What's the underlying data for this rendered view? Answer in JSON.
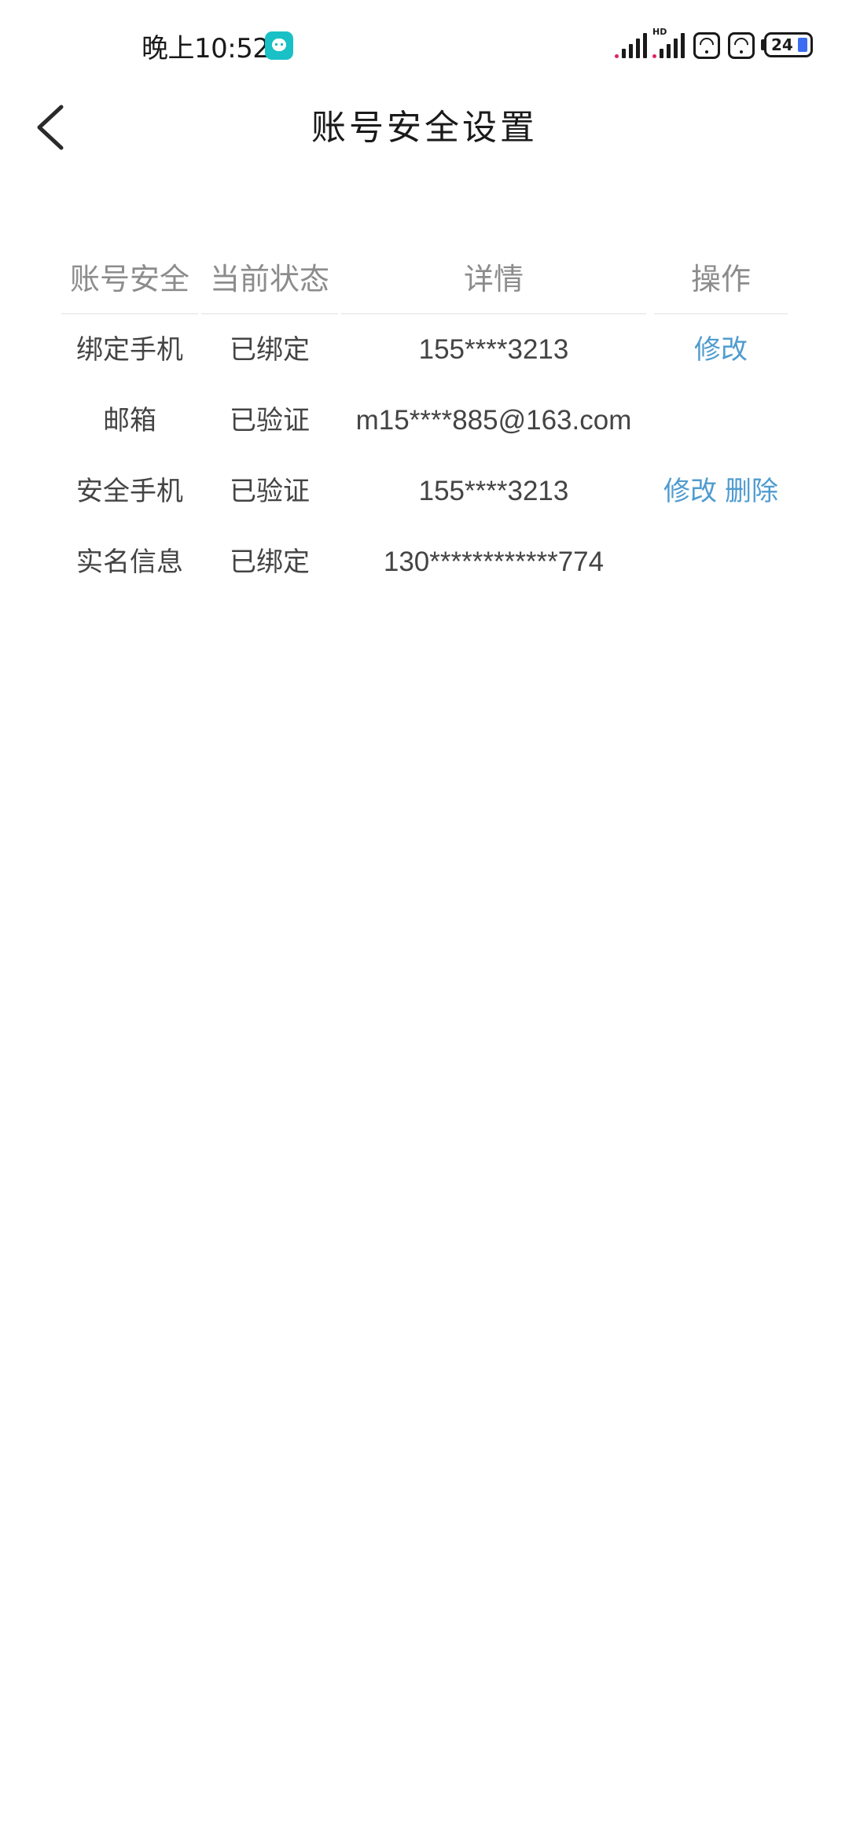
{
  "status_bar": {
    "time": "晚上10:52",
    "app_icon": "chat-bubble-icon",
    "signal_1_icon": "signal-icon",
    "signal_2_hd_label": "HD",
    "signal_2_icon": "signal-hd-icon",
    "wifi_icons": [
      "wifi-icon",
      "wifi-icon"
    ],
    "battery_level": "24"
  },
  "header": {
    "back_icon": "chevron-left-icon",
    "title": "账号安全设置"
  },
  "table": {
    "columns": [
      "账号安全",
      "当前状态",
      "详情",
      "操作"
    ],
    "rows": [
      {
        "item": "绑定手机",
        "status": "已绑定",
        "detail": "155****3213",
        "actions": [
          "修改"
        ]
      },
      {
        "item": "邮箱",
        "status": "已验证",
        "detail": "m15****885@163.com",
        "actions": []
      },
      {
        "item": "安全手机",
        "status": "已验证",
        "detail": "155****3213",
        "actions": [
          "修改",
          "删除"
        ]
      },
      {
        "item": "实名信息",
        "status": "已绑定",
        "detail": "130************774",
        "actions": []
      }
    ]
  },
  "colors": {
    "link": "#4f9ccf",
    "header_text": "#8c8c8c",
    "body_text": "#444444",
    "app_icon_bg": "#19c1c6",
    "battery_fill": "#3a6df0"
  }
}
